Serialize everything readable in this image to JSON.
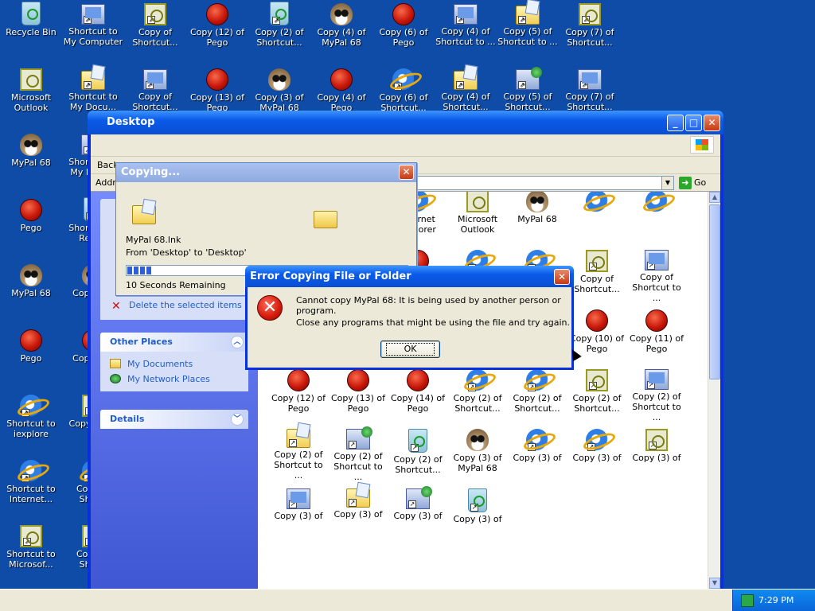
{
  "desktop_icons": [
    {
      "label": "Recycle Bin",
      "icon": "recycle"
    },
    {
      "label": "Shortcut to My Computer",
      "icon": "computer",
      "shortcut": true
    },
    {
      "label": "Copy of Shortcut...",
      "icon": "outlook",
      "shortcut": true
    },
    {
      "label": "Copy (12) of Pego",
      "icon": "pego"
    },
    {
      "label": "Copy (2) of Shortcut...",
      "icon": "recycle",
      "shortcut": true
    },
    {
      "label": "Copy (4) of MyPal 68",
      "icon": "raccoon"
    },
    {
      "label": "Copy (6) of Pego",
      "icon": "pego"
    },
    {
      "label": "Copy (4) of Shortcut to ...",
      "icon": "computer",
      "shortcut": true
    },
    {
      "label": "Copy (5) of Shortcut to ...",
      "icon": "docs",
      "shortcut": true
    },
    {
      "label": "Copy (7) of Shortcut...",
      "icon": "outlook",
      "shortcut": true
    },
    {
      "label": "Microsoft Outlook",
      "icon": "outlook"
    },
    {
      "label": "Shortcut to My Docu...",
      "icon": "docs",
      "shortcut": true
    },
    {
      "label": "Copy of Shortcut...",
      "icon": "computer",
      "shortcut": true
    },
    {
      "label": "Copy (13) of Pego",
      "icon": "pego"
    },
    {
      "label": "Copy (3) of MyPal 68",
      "icon": "raccoon"
    },
    {
      "label": "Copy (4) of Pego",
      "icon": "pego"
    },
    {
      "label": "Copy (6) of Shortcut...",
      "icon": "ie",
      "shortcut": true
    },
    {
      "label": "Copy (4) of Shortcut...",
      "icon": "docs",
      "shortcut": true
    },
    {
      "label": "Copy (5) of Shortcut...",
      "icon": "network",
      "shortcut": true
    },
    {
      "label": "Copy (7) of Shortcut...",
      "icon": "computer",
      "shortcut": true
    },
    {
      "label": "MyPal 68",
      "icon": "raccoon"
    },
    {
      "label": "Shortcut to My Netw...",
      "icon": "network",
      "shortcut": true
    },
    {
      "label": "Pego",
      "icon": "pego"
    },
    {
      "label": "Shortcut to Recy...",
      "icon": "recycle",
      "shortcut": true
    },
    {
      "label": "MyPal 68",
      "icon": "raccoon"
    },
    {
      "label": "Copy of...",
      "icon": "raccoon"
    },
    {
      "label": "Pego",
      "icon": "pego"
    },
    {
      "label": "Copy of...",
      "icon": "pego"
    },
    {
      "label": "Shortcut to iexplore",
      "icon": "ie",
      "shortcut": true
    },
    {
      "label": "Copy of P...",
      "icon": "outlook",
      "shortcut": true
    },
    {
      "label": "Shortcut to Internet...",
      "icon": "ie",
      "shortcut": true
    },
    {
      "label": "Copy of Shor...",
      "icon": "ie",
      "shortcut": true
    },
    {
      "label": "Shortcut to Microsof...",
      "icon": "outlook",
      "shortcut": true
    },
    {
      "label": "Copy of Shor...",
      "icon": "outlook",
      "shortcut": true
    }
  ],
  "explorer": {
    "title": "Desktop",
    "toolbar_back": "Back",
    "address_label": "Address",
    "go_label": "Go",
    "task_delete": "Delete the selected items",
    "other_places_title": "Other Places",
    "other_places": [
      "My Documents",
      "My Network Places"
    ],
    "details_title": "Details",
    "items": [
      {
        "label": "...ork",
        "icon": "network"
      },
      {
        "label": "Recycle Bin",
        "icon": "recycle"
      },
      {
        "label": "Internet Explorer",
        "icon": "ie"
      },
      {
        "label": "Microsoft Outlook",
        "icon": "outlook"
      },
      {
        "label": "MyPal 68",
        "icon": "raccoon"
      },
      {
        "label": "",
        "icon": "ie"
      },
      {
        "label": "",
        "icon": "ie"
      },
      {
        "label": "...rtcut to Microsof...",
        "icon": "outlook",
        "shortcut": true
      },
      {
        "label": "Shortcut to My Computer",
        "icon": "computer",
        "shortcut": true,
        "selected": true
      },
      {
        "label": "...(2) of Pego",
        "icon": "pego"
      },
      {
        "label": "Copy of Shortcut...",
        "icon": "ie",
        "shortcut": true
      },
      {
        "label": "Copy of Shortcut...",
        "icon": "ie",
        "shortcut": true
      },
      {
        "label": "Copy of Shortcut...",
        "icon": "outlook",
        "shortcut": true
      },
      {
        "label": "Copy of Shortcut to ...",
        "icon": "computer",
        "shortcut": true
      },
      {
        "label": "Copy of Shortcut to ...",
        "icon": "docs",
        "shortcut": true
      },
      {
        "label": "Copy of Shortcut to ...",
        "icon": "network",
        "shortcut": true
      },
      {
        "label": "Copy of Shortcut...",
        "icon": "recycle",
        "shortcut": true
      },
      {
        "label": "Copy (3) of Pego",
        "icon": "pego"
      },
      {
        "label": "Copy (2) of MyPal 68",
        "icon": "raccoon"
      },
      {
        "label": "Copy (10) of Pego",
        "icon": "pego"
      },
      {
        "label": "Copy (11) of Pego",
        "icon": "pego"
      },
      {
        "label": "Copy (12) of Pego",
        "icon": "pego"
      },
      {
        "label": "Copy (13) of Pego",
        "icon": "pego"
      },
      {
        "label": "Copy (14) of Pego",
        "icon": "pego"
      },
      {
        "label": "Copy (2) of Shortcut...",
        "icon": "ie",
        "shortcut": true
      },
      {
        "label": "Copy (2) of Shortcut...",
        "icon": "ie",
        "shortcut": true
      },
      {
        "label": "Copy (2) of Shortcut...",
        "icon": "outlook",
        "shortcut": true
      },
      {
        "label": "Copy (2) of Shortcut to ...",
        "icon": "computer",
        "shortcut": true
      },
      {
        "label": "Copy (2) of Shortcut to ...",
        "icon": "docs",
        "shortcut": true
      },
      {
        "label": "Copy (2) of Shortcut to ...",
        "icon": "network",
        "shortcut": true
      },
      {
        "label": "Copy (2) of Shortcut...",
        "icon": "recycle",
        "shortcut": true
      },
      {
        "label": "Copy (3) of MyPal 68",
        "icon": "raccoon"
      },
      {
        "label": "Copy (3) of",
        "icon": "ie",
        "shortcut": true
      },
      {
        "label": "Copy (3) of",
        "icon": "ie",
        "shortcut": true
      },
      {
        "label": "Copy (3) of",
        "icon": "outlook",
        "shortcut": true
      },
      {
        "label": "Copy (3) of",
        "icon": "computer",
        "shortcut": true
      },
      {
        "label": "Copy (3) of",
        "icon": "docs",
        "shortcut": true
      },
      {
        "label": "Copy (3) of",
        "icon": "network",
        "shortcut": true
      },
      {
        "label": "Copy (3) of",
        "icon": "recycle",
        "shortcut": true
      }
    ]
  },
  "copying": {
    "title": "Copying...",
    "file": "MyPal 68.lnk",
    "from_to": "From 'Desktop' to 'Desktop'",
    "remaining": "10 Seconds Remaining",
    "progress_fraction": 0.09
  },
  "error": {
    "title": "Error Copying File or Folder",
    "message1": "Cannot copy MyPal 68: It is being used by another person or program.",
    "message2": "Close any programs that might be using the file and try again.",
    "ok_label": "OK",
    "icon_glyph": "✕"
  },
  "taskbar": {
    "clock": "7:29 PM"
  }
}
